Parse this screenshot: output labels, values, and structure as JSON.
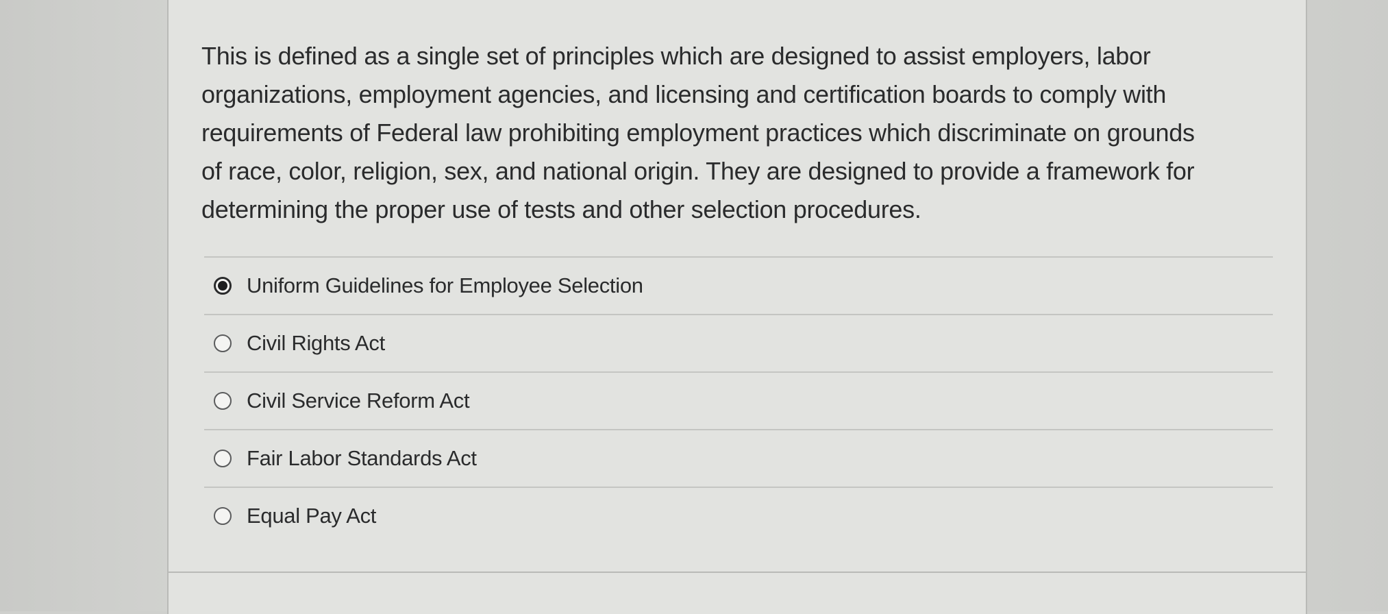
{
  "question": {
    "lines": [
      "This is defined as a single set of principles which are designed to assist employers, labor",
      "organizations, employment agencies, and licensing and certification boards to comply with",
      "requirements of Federal law prohibiting employment practices which discriminate on grounds",
      "of race, color, religion, sex, and national origin. They are designed to provide a framework for",
      "determining the proper use of tests and other selection procedures."
    ]
  },
  "answers": [
    {
      "label": "Uniform Guidelines for Employee Selection",
      "selected": true
    },
    {
      "label": "Civil Rights Act",
      "selected": false
    },
    {
      "label": "Civil Service Reform Act",
      "selected": false
    },
    {
      "label": "Fair Labor Standards Act",
      "selected": false
    },
    {
      "label": "Equal Pay Act",
      "selected": false
    }
  ]
}
